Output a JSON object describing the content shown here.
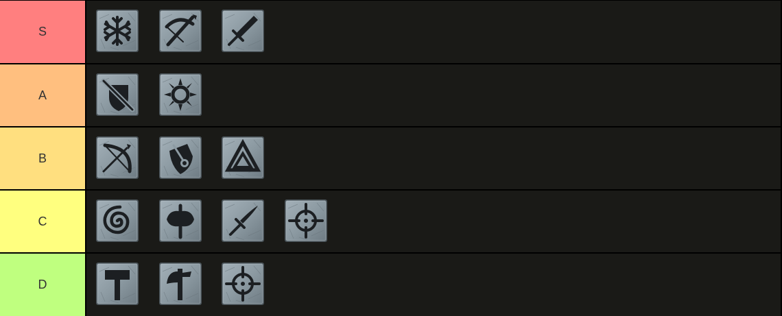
{
  "tiers": [
    {
      "label": "S",
      "color": "#ff7f7f",
      "items": [
        "snowflake-icon",
        "crossbow-icon",
        "sword-icon"
      ]
    },
    {
      "label": "A",
      "color": "#ffbf7f",
      "items": [
        "sword-and-shield-icon",
        "sun-icon"
      ]
    },
    {
      "label": "B",
      "color": "#ffdf7f",
      "items": [
        "bow-icon",
        "shield-mace-icon",
        "triangles-icon"
      ]
    },
    {
      "label": "C",
      "color": "#ffff7f",
      "items": [
        "spiral-icon",
        "battle-axe-icon",
        "dagger-icon",
        "crosshair-icon"
      ]
    },
    {
      "label": "D",
      "color": "#bfff7f",
      "items": [
        "hammer-icon",
        "axe-icon",
        "crosshair-icon"
      ]
    }
  ],
  "colors": {
    "row_background": "#1a1a17",
    "separator": "#000000",
    "tile_face": "#8c9aa2",
    "tile_dark": "#5c6870",
    "glyph": "#1c1f22"
  }
}
